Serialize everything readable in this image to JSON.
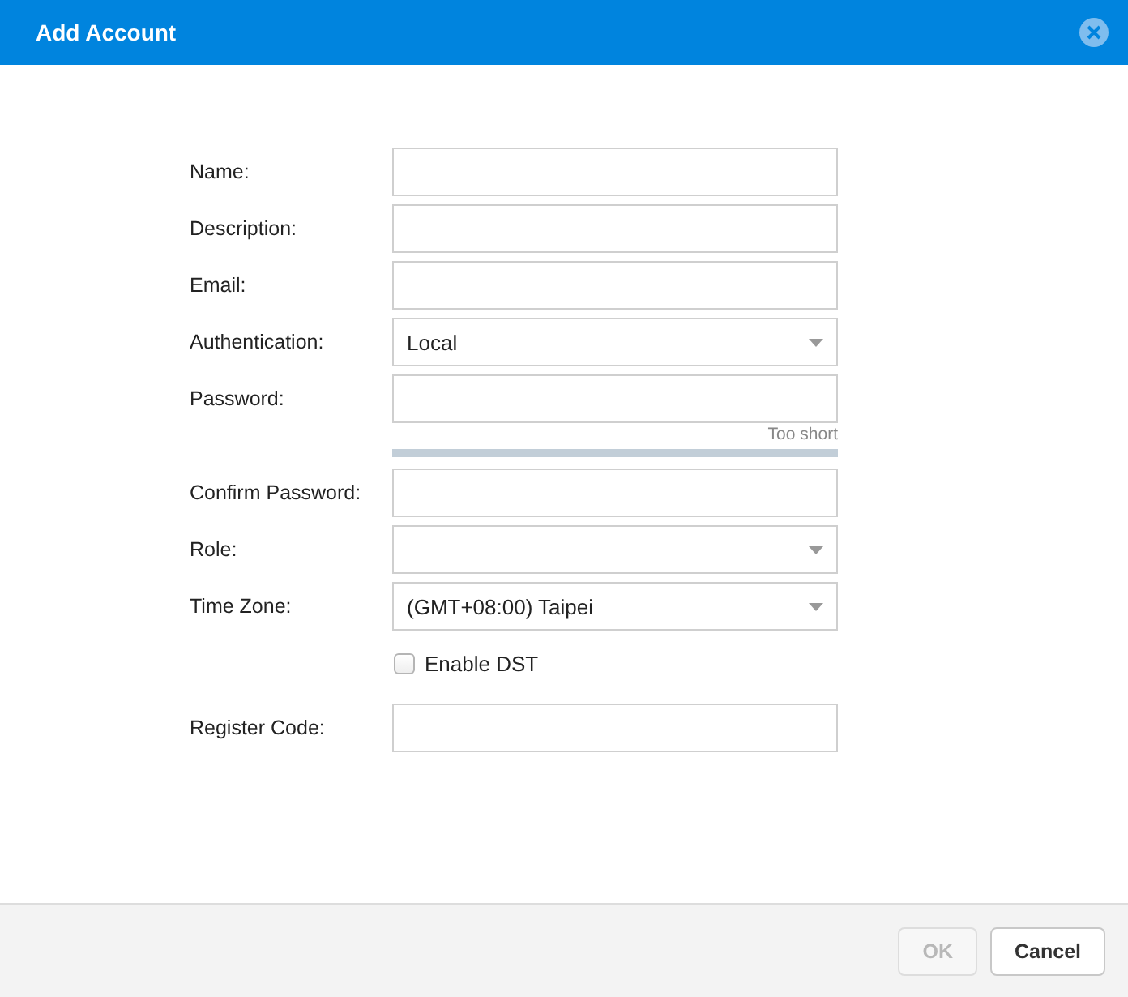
{
  "window": {
    "title": "Add Account"
  },
  "fields": [
    {
      "kind": "text",
      "label": "Name:"
    },
    {
      "kind": "text",
      "label": "Description:"
    },
    {
      "kind": "text",
      "label": "Email:"
    },
    {
      "kind": "select",
      "label": "Authentication:",
      "value": "Local"
    },
    {
      "kind": "password",
      "label": "Password:",
      "strength_text": "Too short",
      "level": 0
    },
    {
      "kind": "password",
      "label": "Confirm Password:"
    },
    {
      "kind": "select",
      "label": "Role:"
    },
    {
      "kind": "select",
      "label": "Time Zone:",
      "value": "(GMT+08:00) Taipei"
    },
    {
      "kind": "checkbox",
      "label": "Enable DST",
      "checked": false
    },
    {
      "kind": "text",
      "label": "Register Code:"
    }
  ],
  "buttons": [
    {
      "label": "OK",
      "disabled": true
    },
    {
      "label": "Cancel",
      "disabled": false
    }
  ]
}
